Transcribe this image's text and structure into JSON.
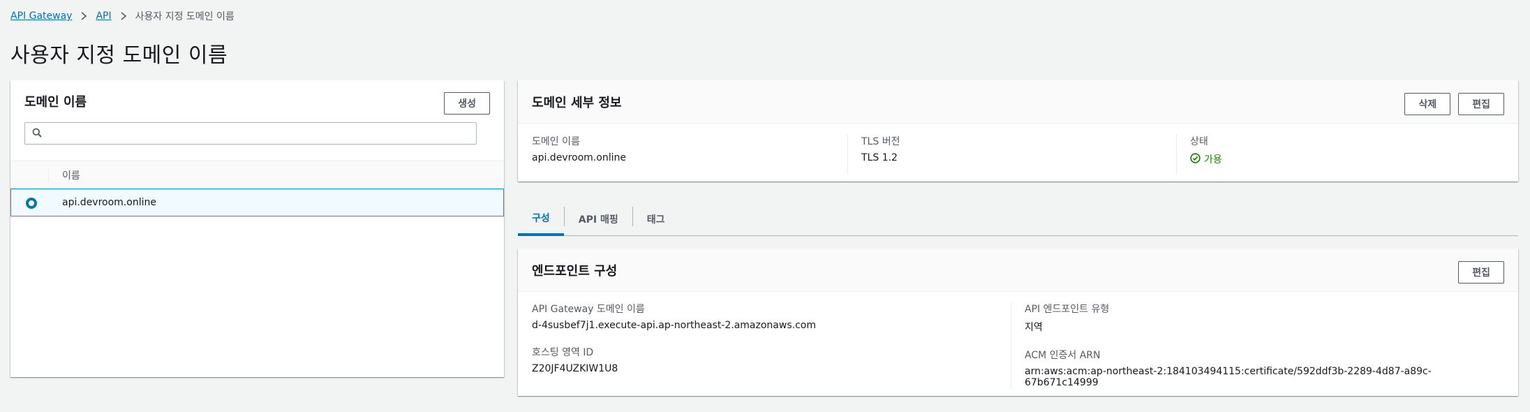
{
  "breadcrumb": {
    "items": [
      "API Gateway",
      "API",
      "사용자 지정 도메인 이름"
    ]
  },
  "page": {
    "title": "사용자 지정 도메인 이름"
  },
  "left_panel": {
    "title": "도메인 이름",
    "create_label": "생성",
    "search": {
      "value": "",
      "placeholder": ""
    },
    "column_header": "이름",
    "rows": [
      {
        "name": "api.devroom.online",
        "selected": true
      }
    ]
  },
  "detail_panel": {
    "title": "도메인 세부 정보",
    "delete_label": "삭제",
    "edit_label": "편집",
    "fields": {
      "domain_name_label": "도메인 이름",
      "domain_name_value": "api.devroom.online",
      "tls_label": "TLS 버전",
      "tls_value": "TLS 1.2",
      "status_label": "상태",
      "status_value": "가용"
    }
  },
  "tabs": [
    {
      "label": "구성",
      "active": true
    },
    {
      "label": "API 매핑",
      "active": false
    },
    {
      "label": "태그",
      "active": false
    }
  ],
  "endpoint_panel": {
    "title": "엔드포인트 구성",
    "edit_label": "편집",
    "gw_domain_label": "API Gateway 도메인 이름",
    "gw_domain_value": "d-4susbef7j1.execute-api.ap-northeast-2.amazonaws.com",
    "hosted_zone_label": "호스팅 영역 ID",
    "hosted_zone_value": "Z20JF4UZKIW1U8",
    "endpoint_type_label": "API 엔드포인트 유형",
    "endpoint_type_value": "지역",
    "acm_arn_label": "ACM 인증서 ARN",
    "acm_arn_value": "arn:aws:acm:ap-northeast-2:184103494115:certificate/592ddf3b-2289-4d87-a89c-67b671c14999"
  },
  "colors": {
    "link": "#0073bb",
    "success": "#1d8102",
    "selected_row_bg": "#f1faff",
    "selected_row_border": "#00a1c9"
  },
  "icons": [
    "chevron-right-icon",
    "search-icon",
    "status-success-icon"
  ]
}
